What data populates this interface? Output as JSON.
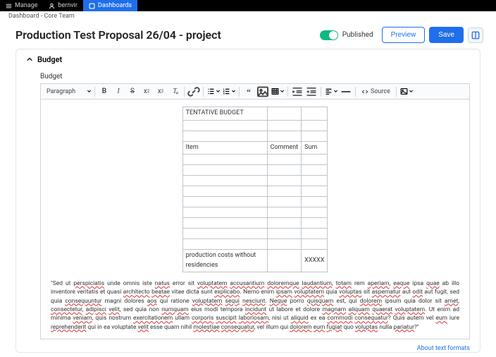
{
  "topbar": {
    "manage": "Manage",
    "user": "bernvir",
    "dash": "Dashboards"
  },
  "breadcrumb": "Dashboard - Core Team",
  "page_title": "Production Test Proposal 26/04 - project",
  "publish_label": "Published",
  "preview_label": "Preview",
  "save_label": "Save",
  "section": {
    "title": "Budget",
    "field_label": "Budget"
  },
  "toolbar": {
    "style_select": "Paragraph",
    "source": "Source"
  },
  "table": {
    "caption": "TENTATIVE BUDGET",
    "head": {
      "item": "Item",
      "comment": "Comment",
      "sum": "Sum"
    },
    "last_row": {
      "item": "production costs without residencies",
      "comment": "",
      "sum": "XXXXX"
    }
  },
  "body_text_prefix": "\"Sed ut ",
  "u1": "perspiciatis",
  "t1": " unde omnis iste ",
  "u2": "natus",
  "t2": " error sit ",
  "u3": "voluptatem",
  "t3": " ",
  "u4": "accusantium",
  "t4": " ",
  "u5": "doloremque",
  "t5": " ",
  "u6": "laudantium",
  "t6": ", ",
  "u7": "totam",
  "t7": " rem ",
  "u8": "aperiam",
  "t8": ", ",
  "u9": "eaque",
  "t9": " ipsa ",
  "u10": "quae",
  "t10": " ab illo inventore veritatis et quasi ",
  "u11": "architecto",
  "t11": " ",
  "u12": "beatae",
  "t12": " vitae dicta sunt ",
  "u13": "explicabo",
  "t13": ". Nemo enim ",
  "u14": "ipsam",
  "t14": " ",
  "u15": "voluptatem",
  "t15": " quia ",
  "u16": "voluptas",
  "t16": " sit ",
  "u17": "aspernatur",
  "t17": " aut ",
  "u18": "odit",
  "t18": " aut fugit, sed quia ",
  "u19": "consequuntur",
  "t19": " magni dolores ",
  "u20": "aos",
  "t20": " qui ratione ",
  "u21": "voluptatem",
  "t21": " ",
  "u22": "sequi",
  "t22": " ",
  "u23": "nesciunt",
  "t23": ". ",
  "u24": "Neque",
  "t24": " porro ",
  "u25": "quisquam",
  "t25": " est, qui ",
  "u26": "dolorem",
  "t26": " ipsum quia dolor sit ",
  "u27": "amet",
  "t27": ", ",
  "u28": "consectetur",
  "t28": ", ",
  "u29": "adipisci",
  "t29": " ",
  "u30": "velit",
  "t30": ", sed quia non ",
  "u31": "numquam",
  "t31": " eius modi tempora ",
  "u32": "incidunt",
  "t32": " ut labore et dolore ",
  "u33": "magnam",
  "t33": " ",
  "u34": "aliquam",
  "t34": " ",
  "u35": "quaerat",
  "t35": " ",
  "u36": "voluptatem",
  "t36": ". Ut enim ad minima ",
  "u37": "veniam",
  "t37": ", quis nostrum ",
  "u38": "exercitationem",
  "t38": " ullam ",
  "u39": "corporis",
  "t39": " ",
  "u40": "suscipit",
  "t40": " ",
  "u41": "laboriosam",
  "t41": ", nisi ut ",
  "u42": "aliquid",
  "t42": " ex ea ",
  "u43": "commodi",
  "t43": " ",
  "u44": "consequatur",
  "t44": "? Quis autem vel ",
  "u45": "eum",
  "t45": " iure ",
  "u46": "reprehenderit",
  "t46": " qui in ea voluptate ",
  "u47": "velit",
  "t47": " esse quam nihil ",
  "u48": "molestiae",
  "t48": " ",
  "u49": "consequatur",
  "t49": ", vel illum qui ",
  "u50": "dolorem",
  "t50": " ",
  "u51": "eum",
  "t51": " ",
  "u52": "fugiat",
  "t52": " quo ",
  "u53": "voluptas",
  "t53": " nulla ",
  "u54": "pariatur",
  "t54": "?\"",
  "footer_link": "About text formats"
}
